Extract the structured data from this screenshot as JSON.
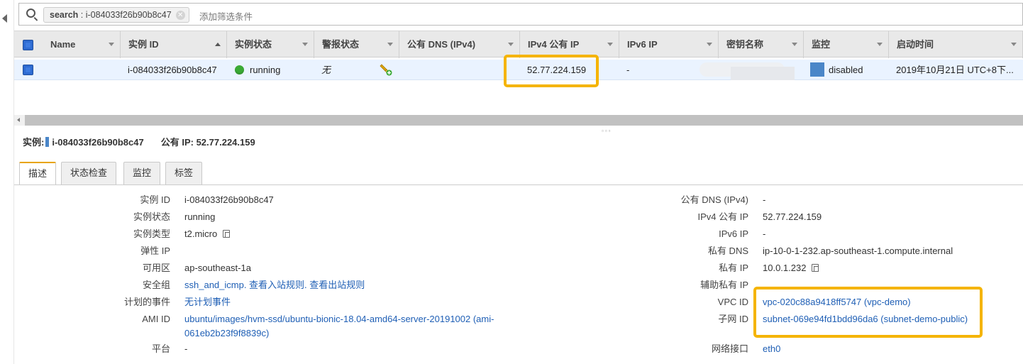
{
  "filter": {
    "chip_key": "search",
    "chip_sep": " : ",
    "chip_value": "i-084033f26b90b8c47",
    "placeholder": "添加筛选条件"
  },
  "table": {
    "columns": [
      "Name",
      "实例 ID",
      "实例状态",
      "警报状态",
      "公有 DNS (IPv4)",
      "IPv4 公有 IP",
      "IPv6 IP",
      "密钥名称",
      "监控",
      "启动时间"
    ],
    "row": {
      "name": "",
      "instance_id": "i-084033f26b90b8c47",
      "state": "running",
      "alarm": "无",
      "public_dns": "",
      "ipv4_public_ip": "52.77.224.159",
      "ipv6_ip": "-",
      "key_name": "",
      "monitoring": "disabled",
      "launch_time": "2019年10月21日 UTC+8下..."
    }
  },
  "summary": {
    "instance_label": "实例:",
    "instance_id": "i-084033f26b90b8c47",
    "public_ip_label": "公有 IP:",
    "public_ip": "52.77.224.159"
  },
  "tabs": [
    "描述",
    "状态检查",
    "监控",
    "标签"
  ],
  "details_left": [
    {
      "label": "实例 ID",
      "value": "i-084033f26b90b8c47"
    },
    {
      "label": "实例状态",
      "value": "running"
    },
    {
      "label": "实例类型",
      "value": "t2.micro"
    },
    {
      "label": "弹性 IP",
      "value": ""
    },
    {
      "label": "可用区",
      "value": "ap-southeast-1a"
    },
    {
      "label": "安全组",
      "value": "ssh_and_icmp. 查看入站规则. 查看出站规则"
    },
    {
      "label": "计划的事件",
      "value": "无计划事件"
    },
    {
      "label": "AMI ID",
      "value": "ubuntu/images/hvm-ssd/ubuntu-bionic-18.04-amd64-server-20191002 (ami-",
      "value2": "061eb2b23f9f8839c)"
    },
    {
      "label": "平台",
      "value": "-"
    }
  ],
  "details_right": [
    {
      "label": "公有 DNS (IPv4)",
      "value": "-"
    },
    {
      "label": "IPv4 公有 IP",
      "value": "52.77.224.159"
    },
    {
      "label": "IPv6 IP",
      "value": "-"
    },
    {
      "label": "私有 DNS",
      "value": "ip-10-0-1-232.ap-southeast-1.compute.internal"
    },
    {
      "label": "私有 IP",
      "value": "10.0.1.232"
    },
    {
      "label": "辅助私有 IP",
      "value": ""
    },
    {
      "label": "VPC ID",
      "value": "vpc-020c88a9418ff5747 (vpc-demo)"
    },
    {
      "label": "子网 ID",
      "value": "subnet-069e94fd1bdd96da6 (subnet-demo-public)"
    },
    {
      "label": "网络接口",
      "value": "eth0"
    }
  ],
  "colors": {
    "highlight": "#f5b400",
    "link": "#1f5fb5",
    "running": "#3aaa35",
    "selected_row": "#eaf3ff"
  }
}
